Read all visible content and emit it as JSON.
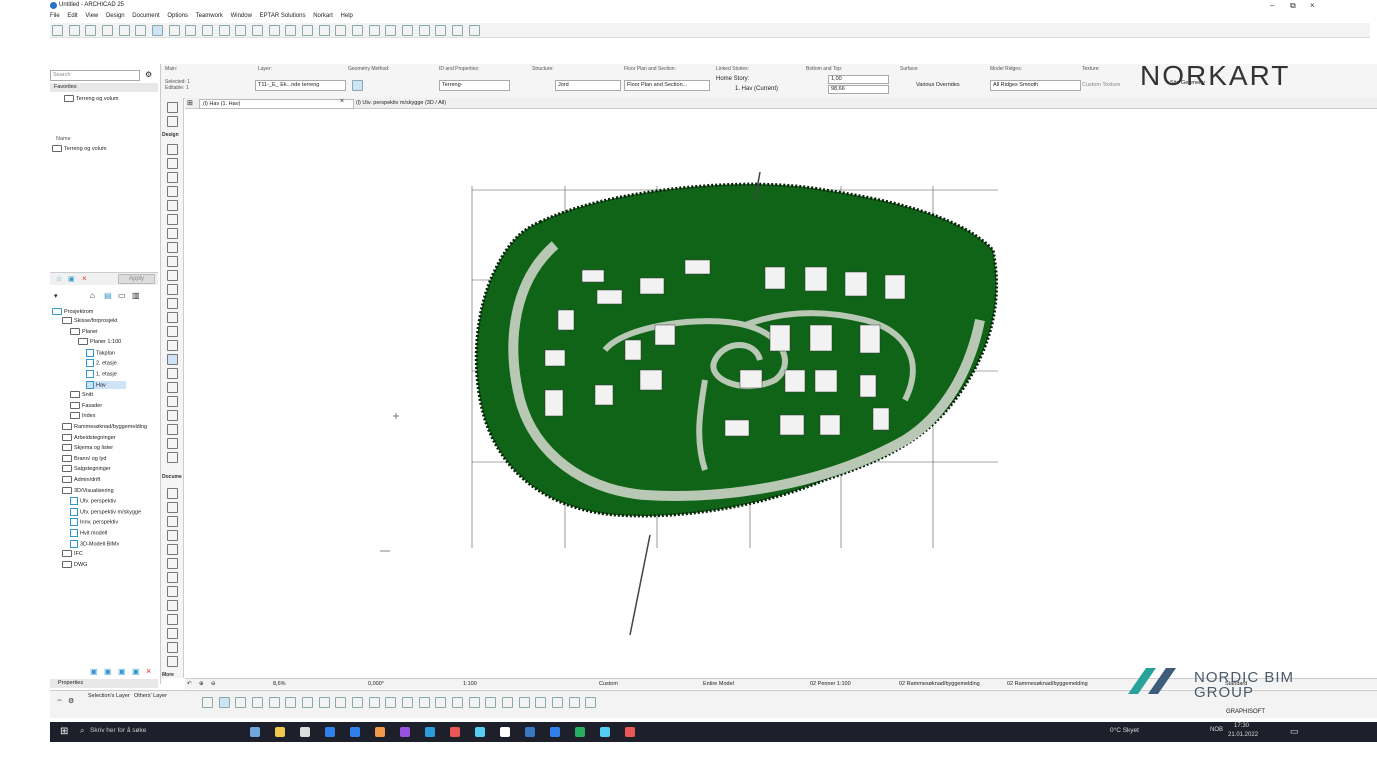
{
  "window": {
    "title": "Untitled - ARCHICAD 25",
    "controls": [
      "–",
      "⧉",
      "×"
    ]
  },
  "menu": [
    "File",
    "Edit",
    "View",
    "Design",
    "Document",
    "Options",
    "Teamwork",
    "Window",
    "EPTAR Solutions",
    "Norkart",
    "Help"
  ],
  "search": {
    "placeholder": "Search"
  },
  "favorites": {
    "header": "Favorites",
    "items": [
      "Terreng og volum"
    ],
    "name_column": "Name",
    "list": [
      "Terreng og volum"
    ]
  },
  "navigator": {
    "apply_label": "Apply",
    "root": "Prosjektrom",
    "tree": [
      {
        "label": "Skisse/forprosjekt",
        "level": 1
      },
      {
        "label": "Planer",
        "level": 2
      },
      {
        "label": "Planer 1:100",
        "level": 3
      },
      {
        "label": "Takplan",
        "level": 4
      },
      {
        "label": "2. etasje",
        "level": 4
      },
      {
        "label": "1. etasje",
        "level": 4
      },
      {
        "label": "Hav",
        "level": 4,
        "selected": true
      },
      {
        "label": "Snitt",
        "level": 2
      },
      {
        "label": "Fasader",
        "level": 2
      },
      {
        "label": "Index",
        "level": 2
      },
      {
        "label": "Rammesøknad/byggemelding",
        "level": 1
      },
      {
        "label": "Arbeidstegninger",
        "level": 1
      },
      {
        "label": "Skjema og lister",
        "level": 1
      },
      {
        "label": "Brann/ og lyd",
        "level": 1
      },
      {
        "label": "Salgstegninger",
        "level": 1
      },
      {
        "label": "Admin/drift",
        "level": 1
      },
      {
        "label": "3D/Visualisering",
        "level": 1
      },
      {
        "label": "Utv. perspektiv",
        "level": 2
      },
      {
        "label": "Utv. perspektiv m/skygge",
        "level": 2
      },
      {
        "label": "Innv. perspektiv",
        "level": 2
      },
      {
        "label": "Hvit modell",
        "level": 2
      },
      {
        "label": "3D-Modell BIMx",
        "level": 2
      },
      {
        "label": "IFC",
        "level": 1
      },
      {
        "label": "DWG",
        "level": 1
      }
    ]
  },
  "infobox": {
    "main_label": "Main:",
    "selected": "Selected: 1",
    "editable": "Editable: 1",
    "layer_label": "Layer:",
    "layer_value": "T11-_E_ Ek...nde terreng",
    "geometry_label": "Geometry Method:",
    "id_label": "ID and Properties:",
    "id_value": "Terreng-",
    "structure_label": "Structure:",
    "structure_value": "Jord",
    "floorplan_label": "Floor Plan and Section:",
    "floorplan_value": "Floor Plan and Section...",
    "stories_label": "Linked Stories:",
    "home_story": "Home Story:",
    "home_story_value": "1. Hav (Current)",
    "bottomtop_label": "Bottom and Top:",
    "top_value": "1,00",
    "bottom_value": "98,66",
    "surface_label": "Surface:",
    "surface_value": "Various Overrides",
    "ridges_label": "Model Ridges:",
    "ridges_value": "All Ridges Smooth",
    "texture_label": "Texture:",
    "texture_value": "Custom Texture",
    "geometry2_label": "Geometry:",
    "geometry2_value": "Site Geometry"
  },
  "tabs": [
    {
      "label": "(l) Hav (1. Hav)",
      "active": true
    },
    {
      "label": "(l) Utv. perspektiv m/skygge (3D / All)",
      "active": false
    }
  ],
  "toolbox_headers": [
    "Design",
    "Docume",
    "More"
  ],
  "bottom_status": {
    "zoom": "8,6%",
    "angle": "0,000°",
    "scale": "1:100",
    "layer_combo": "Custom",
    "model_view": "Entire Model",
    "pen_set": "02 Penner 1:100",
    "override": "02 Rammesøknad/byggemelding",
    "renovation": "02 Rammesøknad/byggemelding",
    "filter": "Standard"
  },
  "layer_toggles": [
    "Selection's Layer",
    "Others' Layer"
  ],
  "properties_label": "Properties",
  "brand_top": "NORKART",
  "brand_bottom": [
    "NORDIC BIM",
    "GROUP"
  ],
  "graphisoft": "GRAPHISOFT",
  "taskbar": {
    "search_placeholder": "Skriv her for å søke",
    "weather": "0°C Skyet",
    "lang": "NOB",
    "time": "17:30",
    "date": "21.01.2022"
  },
  "colors": {
    "terrain": "#0f6418",
    "road": "#b8c8b4",
    "building": "#f2f2f2",
    "accent": "#3a78c2"
  }
}
